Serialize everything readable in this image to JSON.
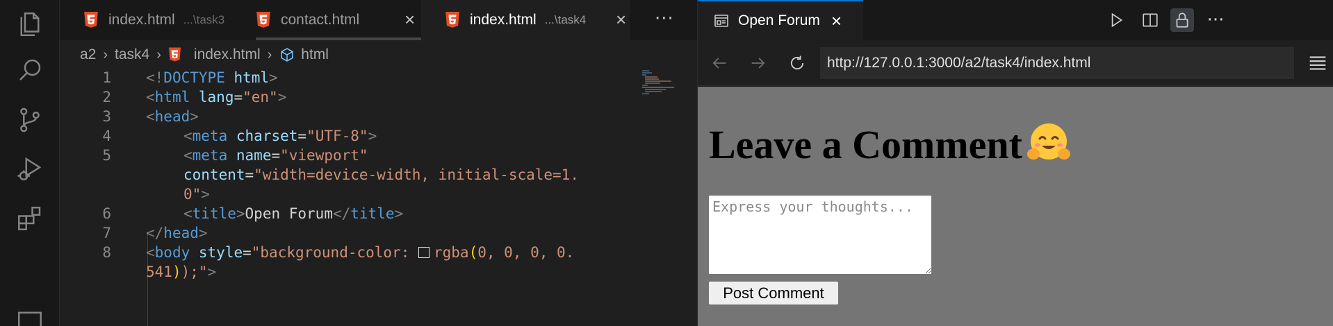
{
  "activity_bar": {
    "icons": [
      "files-icon",
      "search-icon",
      "source-control-icon",
      "run-debug-icon",
      "extensions-icon",
      "remote-icon"
    ]
  },
  "editor": {
    "tabs": [
      {
        "label": "index.html",
        "hint": "...\\task3",
        "active": false
      },
      {
        "label": "contact.html",
        "hint": "",
        "active": false
      },
      {
        "label": "index.html",
        "hint": "...\\task4",
        "active": true
      }
    ],
    "breadcrumb": [
      "a2",
      "task4",
      "index.html",
      "html"
    ],
    "lines": [
      {
        "n": "1"
      },
      {
        "n": "2"
      },
      {
        "n": "3"
      },
      {
        "n": "4"
      },
      {
        "n": "5"
      },
      {
        "n": ""
      },
      {
        "n": ""
      },
      {
        "n": "6"
      },
      {
        "n": "7"
      },
      {
        "n": "8"
      },
      {
        "n": ""
      }
    ],
    "code": {
      "l1_kw": "DOCTYPE",
      "l1_name": "html",
      "l2_tag": "html",
      "l2_attr": "lang",
      "l2_val": "\"en\"",
      "l3_tag": "head",
      "l4_tag": "meta",
      "l4_attr": "charset",
      "l4_val": "\"UTF-8\"",
      "l5_tag": "meta",
      "l5_attr": "name",
      "l5_val": "\"viewport\"",
      "l5b_attr": "content",
      "l5b_val": "\"width=device-width, initial-scale=1.",
      "l5c_val": "0\"",
      "l6_tag": "title",
      "l6_text": "Open Forum",
      "l7_tag": "head",
      "l8_tag": "body",
      "l8_attr": "style",
      "l8_val": "\"background-color: ",
      "l8_fn": "rgba",
      "l8_args": "0, 0, 0, 0.",
      "l8b_num": "541",
      "l8b_end": ");\""
    }
  },
  "browser": {
    "tab_title": "Open Forum",
    "url": "http://127.0.0.1:3000/a2/task4/index.html",
    "page": {
      "heading": "Leave a Comment",
      "textarea_placeholder": "Express your thoughts...",
      "button_label": "Post Comment"
    }
  },
  "colors": {
    "accent": "#0078d4",
    "html_icon": "#e44d26",
    "page_bg": "#757575"
  }
}
